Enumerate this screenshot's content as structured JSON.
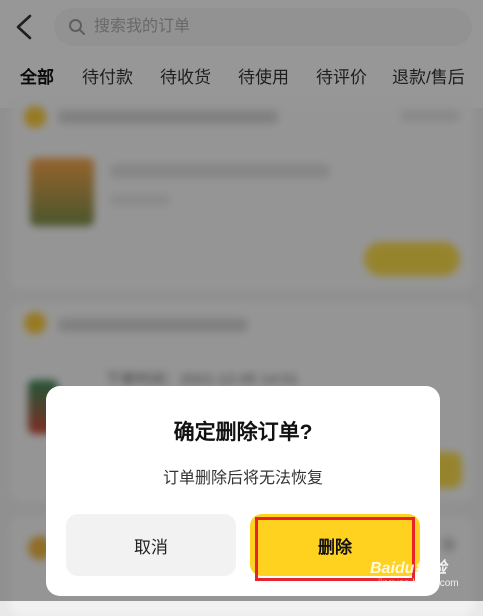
{
  "header": {
    "search_placeholder": "搜索我的订单",
    "tabs": [
      "全部",
      "待付款",
      "待收货",
      "待使用",
      "待评价",
      "退款/售后"
    ]
  },
  "background": {
    "order_time": "下单时间：2021-12-05 14:51",
    "ghost_text": "消"
  },
  "dialog": {
    "title": "确定删除订单?",
    "message": "订单删除后将无法恢复",
    "cancel_label": "取消",
    "delete_label": "删除"
  },
  "watermark": {
    "brand": "Baidu经验",
    "sub": "jingyan.baidu.com"
  },
  "colors": {
    "accent": "#ffd21f",
    "highlight": "#e8242a"
  }
}
